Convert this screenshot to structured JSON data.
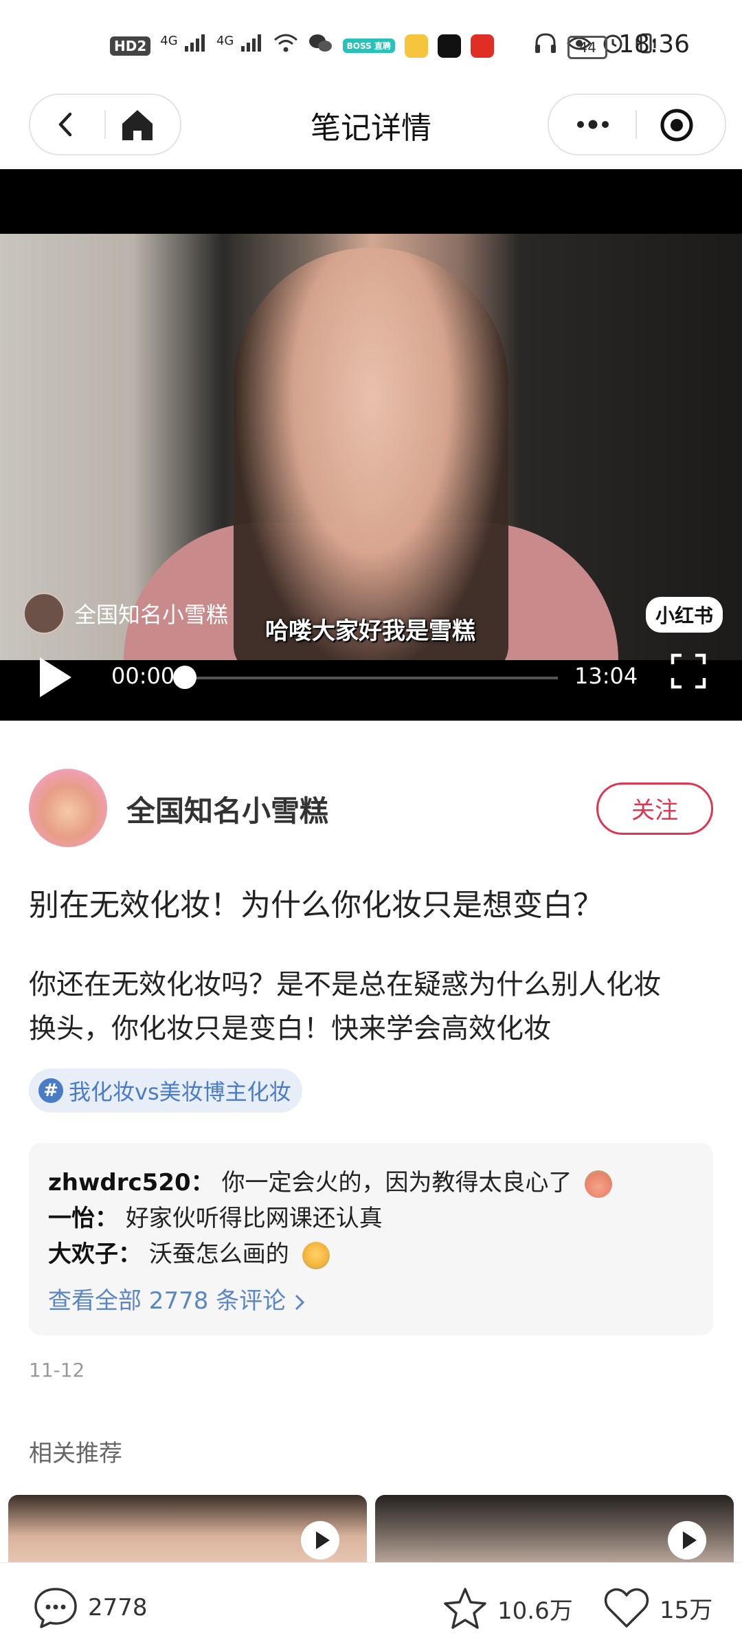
{
  "status_bar": {
    "time": "18:36",
    "battery": "44",
    "signal_labels": [
      "HD2",
      "4G",
      "4G"
    ],
    "app_badges": [
      "BOSS 直聘",
      "微博",
      "抖音",
      "拼多多"
    ]
  },
  "nav": {
    "title": "笔记详情",
    "back_icon": "chevron-left-icon",
    "home_icon": "home-icon",
    "more_icon": "more-dots-icon",
    "target_icon": "record-target-icon"
  },
  "video": {
    "author_overlay": "全国知名小雪糕",
    "subtitle": "哈喽大家好我是雪糕",
    "watermark": "小红书",
    "current_time": "00:00",
    "total_time": "13:04",
    "progress": 0
  },
  "author": {
    "name": "全国知名小雪糕",
    "follow_label": "关注"
  },
  "note": {
    "title": "别在无效化妆！为什么你化妆只是想变白？",
    "body_line1": "你还在无效化妆吗？是不是总在疑惑为什么别人化妆",
    "body_line2": "换头，你化妆只是变白！快来学会高效化妆",
    "tag_symbol": "#",
    "tag": "我化妆vs美妆博主化妆",
    "date": "11-12"
  },
  "comments": {
    "items": [
      {
        "user": "zhwdrc520：",
        "text": "你一定会火的，因为教得太良心了"
      },
      {
        "user": "一怡：",
        "text": "好家伙听得比网课还认真"
      },
      {
        "user": "大欢子：",
        "text": "沃蚕怎么画的"
      }
    ],
    "view_all": "查看全部 2778 条评论"
  },
  "related": {
    "title": "相关推荐"
  },
  "bottom_bar": {
    "comment_count": "2778",
    "favorite_count": "10.6万",
    "like_count": "15万"
  },
  "colors": {
    "accent": "#e03550",
    "link": "#5a86c2",
    "tag_bg": "#e8eef8"
  }
}
